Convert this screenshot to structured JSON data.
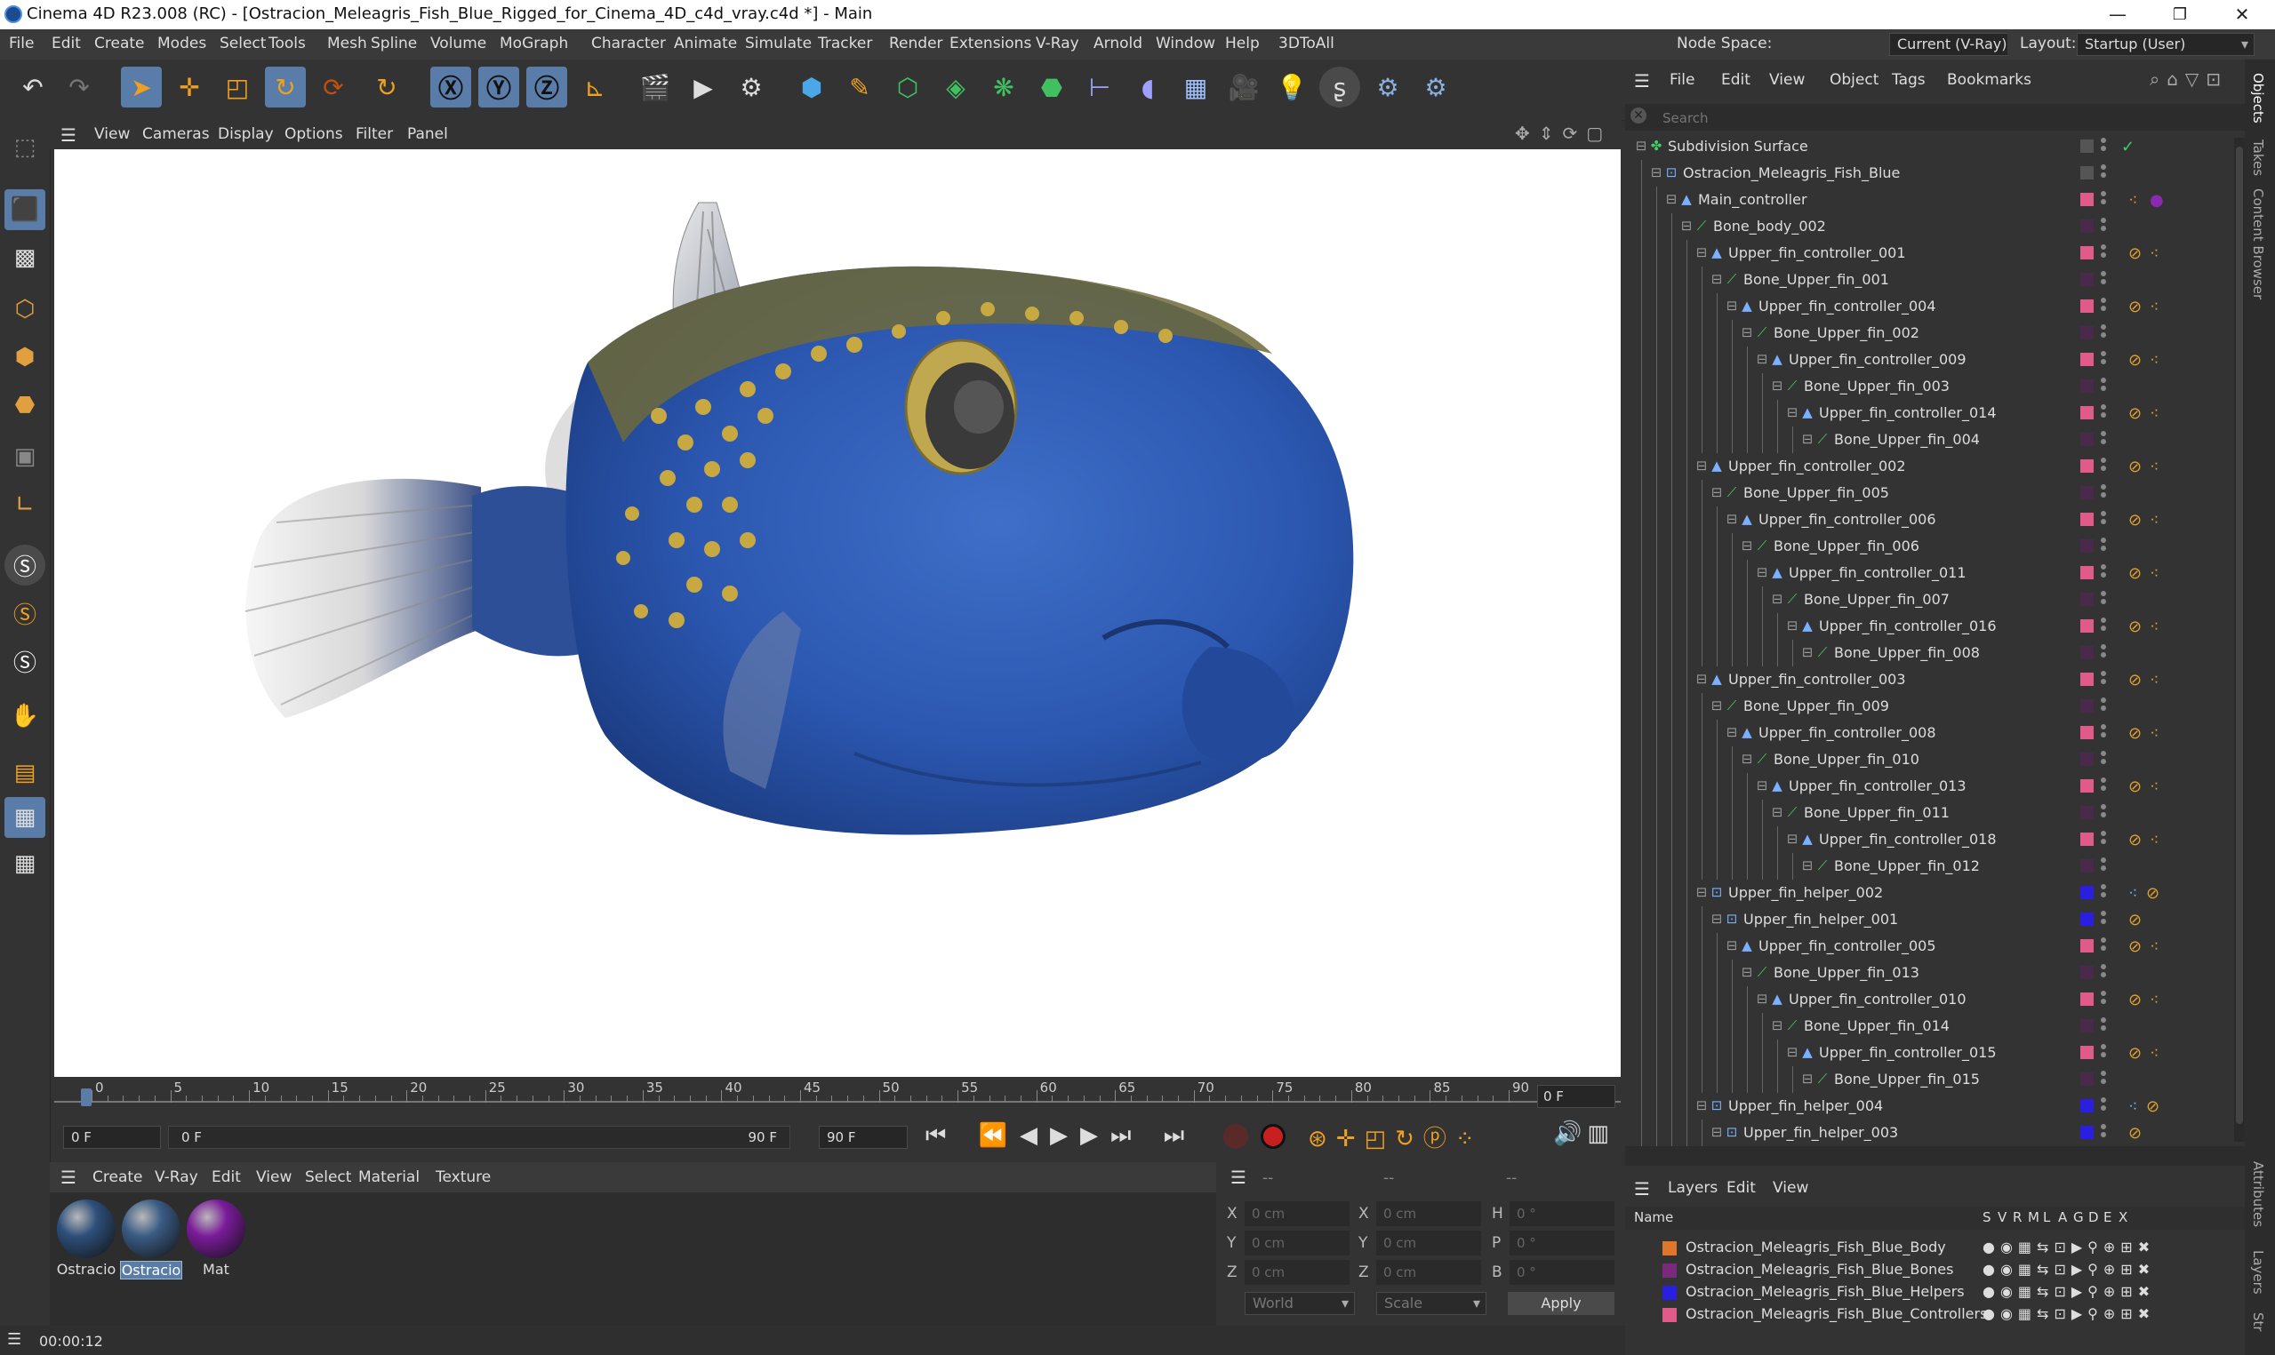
{
  "window": {
    "title": "Cinema 4D R23.008 (RC) - [Ostracion_Meleagris_Fish_Blue_Rigged_for_Cinema_4D_c4d_vray.c4d *] - Main",
    "controls": [
      "—",
      "❐",
      "✕"
    ]
  },
  "menu": [
    "File",
    "Edit",
    "Create",
    "Modes",
    "Select",
    "Tools",
    "Mesh",
    "Spline",
    "Volume",
    "MoGraph",
    "Character",
    "Animate",
    "Simulate",
    "Tracker",
    "Render",
    "Extensions",
    "V-Ray",
    "Arnold",
    "Window",
    "Help",
    "3DToAll"
  ],
  "node_space": {
    "label": "Node Space:",
    "value": "Current (V-Ray)"
  },
  "layout": {
    "label": "Layout:",
    "value": "Startup (User)"
  },
  "viewport_menu": [
    "View",
    "Cameras",
    "Display",
    "Options",
    "Filter",
    "Panel"
  ],
  "timeline": {
    "ticks": [
      "0",
      "5",
      "10",
      "15",
      "20",
      "25",
      "30",
      "35",
      "40",
      "45",
      "50",
      "55",
      "60",
      "65",
      "70",
      "75",
      "80",
      "85",
      "90"
    ],
    "current_frame": "0 F",
    "start_field": "0 F",
    "range_start": "0 F",
    "range_end": "90 F",
    "end_field": "90 F"
  },
  "material_menu": [
    "Create",
    "V-Ray",
    "Edit",
    "View",
    "Select",
    "Material",
    "Texture"
  ],
  "materials": [
    {
      "label": "Ostracio",
      "color": "#2d4f7a",
      "selected": false
    },
    {
      "label": "Ostracio",
      "color": "#3a5b84",
      "selected": true
    },
    {
      "label": "Mat",
      "color": "#7a1b9a",
      "selected": false
    }
  ],
  "coords": {
    "header_dashes": [
      "--",
      "--",
      "--"
    ],
    "rows": [
      {
        "a": "X",
        "av": "0 cm",
        "b": "X",
        "bv": "0 cm",
        "c": "H",
        "cv": "0 °"
      },
      {
        "a": "Y",
        "av": "0 cm",
        "b": "Y",
        "bv": "0 cm",
        "c": "P",
        "cv": "0 °"
      },
      {
        "a": "Z",
        "av": "0 cm",
        "b": "Z",
        "bv": "0 cm",
        "c": "B",
        "cv": "0 °"
      }
    ],
    "mode": "World",
    "scale": "Scale",
    "apply": "Apply"
  },
  "status_time": "00:00:12",
  "object_menu": [
    "File",
    "Edit",
    "View",
    "Object",
    "Tags",
    "Bookmarks"
  ],
  "search_placeholder": "Search",
  "objects": [
    {
      "name": "Subdivision Surface",
      "depth": 0,
      "type": "subd",
      "color": "#555",
      "tags": "check"
    },
    {
      "name": "Ostracion_Meleagris_Fish_Blue",
      "depth": 1,
      "type": "null",
      "color": "#555",
      "tags": ""
    },
    {
      "name": "Main_controller",
      "depth": 2,
      "type": "ctrl",
      "color": "#e05a8a",
      "tags": "matsphere"
    },
    {
      "name": "Bone_body_002",
      "depth": 3,
      "type": "bone",
      "color": "#4a2a4a",
      "tags": ""
    },
    {
      "name": "Upper_fin_controller_001",
      "depth": 4,
      "type": "ctrl",
      "color": "#e05a8a",
      "tags": "ctag"
    },
    {
      "name": "Bone_Upper_fin_001",
      "depth": 5,
      "type": "bone",
      "color": "#4a2a4a",
      "tags": ""
    },
    {
      "name": "Upper_fin_controller_004",
      "depth": 6,
      "type": "ctrl",
      "color": "#e05a8a",
      "tags": "ctag"
    },
    {
      "name": "Bone_Upper_fin_002",
      "depth": 7,
      "type": "bone",
      "color": "#4a2a4a",
      "tags": ""
    },
    {
      "name": "Upper_fin_controller_009",
      "depth": 8,
      "type": "ctrl",
      "color": "#e05a8a",
      "tags": "ctag"
    },
    {
      "name": "Bone_Upper_fin_003",
      "depth": 9,
      "type": "bone",
      "color": "#4a2a4a",
      "tags": ""
    },
    {
      "name": "Upper_fin_controller_014",
      "depth": 10,
      "type": "ctrl",
      "color": "#e05a8a",
      "tags": "ctag"
    },
    {
      "name": "Bone_Upper_fin_004",
      "depth": 11,
      "type": "bone",
      "color": "#4a2a4a",
      "tags": ""
    },
    {
      "name": "Upper_fin_controller_002",
      "depth": 4,
      "type": "ctrl",
      "color": "#e05a8a",
      "tags": "ctag"
    },
    {
      "name": "Bone_Upper_fin_005",
      "depth": 5,
      "type": "bone",
      "color": "#4a2a4a",
      "tags": ""
    },
    {
      "name": "Upper_fin_controller_006",
      "depth": 6,
      "type": "ctrl",
      "color": "#e05a8a",
      "tags": "ctag"
    },
    {
      "name": "Bone_Upper_fin_006",
      "depth": 7,
      "type": "bone",
      "color": "#4a2a4a",
      "tags": ""
    },
    {
      "name": "Upper_fin_controller_011",
      "depth": 8,
      "type": "ctrl",
      "color": "#e05a8a",
      "tags": "ctag"
    },
    {
      "name": "Bone_Upper_fin_007",
      "depth": 9,
      "type": "bone",
      "color": "#4a2a4a",
      "tags": ""
    },
    {
      "name": "Upper_fin_controller_016",
      "depth": 10,
      "type": "ctrl",
      "color": "#e05a8a",
      "tags": "ctag"
    },
    {
      "name": "Bone_Upper_fin_008",
      "depth": 11,
      "type": "bone",
      "color": "#4a2a4a",
      "tags": ""
    },
    {
      "name": "Upper_fin_controller_003",
      "depth": 4,
      "type": "ctrl",
      "color": "#e05a8a",
      "tags": "ctag"
    },
    {
      "name": "Bone_Upper_fin_009",
      "depth": 5,
      "type": "bone",
      "color": "#4a2a4a",
      "tags": ""
    },
    {
      "name": "Upper_fin_controller_008",
      "depth": 6,
      "type": "ctrl",
      "color": "#e05a8a",
      "tags": "ctag"
    },
    {
      "name": "Bone_Upper_fin_010",
      "depth": 7,
      "type": "bone",
      "color": "#4a2a4a",
      "tags": ""
    },
    {
      "name": "Upper_fin_controller_013",
      "depth": 8,
      "type": "ctrl",
      "color": "#e05a8a",
      "tags": "ctag"
    },
    {
      "name": "Bone_Upper_fin_011",
      "depth": 9,
      "type": "bone",
      "color": "#4a2a4a",
      "tags": ""
    },
    {
      "name": "Upper_fin_controller_018",
      "depth": 10,
      "type": "ctrl",
      "color": "#e05a8a",
      "tags": "ctag"
    },
    {
      "name": "Bone_Upper_fin_012",
      "depth": 11,
      "type": "bone",
      "color": "#4a2a4a",
      "tags": ""
    },
    {
      "name": "Upper_fin_helper_002",
      "depth": 4,
      "type": "null",
      "color": "#2a1fe0",
      "tags": "htag"
    },
    {
      "name": "Upper_fin_helper_001",
      "depth": 5,
      "type": "null",
      "color": "#2a1fe0",
      "tags": "prot"
    },
    {
      "name": "Upper_fin_controller_005",
      "depth": 6,
      "type": "ctrl",
      "color": "#e05a8a",
      "tags": "ctag"
    },
    {
      "name": "Bone_Upper_fin_013",
      "depth": 7,
      "type": "bone",
      "color": "#4a2a4a",
      "tags": ""
    },
    {
      "name": "Upper_fin_controller_010",
      "depth": 8,
      "type": "ctrl",
      "color": "#e05a8a",
      "tags": "ctag"
    },
    {
      "name": "Bone_Upper_fin_014",
      "depth": 9,
      "type": "bone",
      "color": "#4a2a4a",
      "tags": ""
    },
    {
      "name": "Upper_fin_controller_015",
      "depth": 10,
      "type": "ctrl",
      "color": "#e05a8a",
      "tags": "ctag"
    },
    {
      "name": "Bone_Upper_fin_015",
      "depth": 11,
      "type": "bone",
      "color": "#4a2a4a",
      "tags": ""
    },
    {
      "name": "Upper_fin_helper_004",
      "depth": 4,
      "type": "null",
      "color": "#2a1fe0",
      "tags": "htag"
    },
    {
      "name": "Upper_fin_helper_003",
      "depth": 5,
      "type": "null",
      "color": "#2a1fe0",
      "tags": "prot"
    }
  ],
  "layers_menu": [
    "Layers",
    "Edit",
    "View"
  ],
  "layers_header": {
    "name": "Name",
    "cols": [
      "S",
      "V",
      "R",
      "M",
      "L",
      "A",
      "G",
      "D",
      "E",
      "X"
    ]
  },
  "layers": [
    {
      "name": "Ostracion_Meleagris_Fish_Blue_Body",
      "color": "#e0762a"
    },
    {
      "name": "Ostracion_Meleagris_Fish_Blue_Bones",
      "color": "#7a2a7a"
    },
    {
      "name": "Ostracion_Meleagris_Fish_Blue_Helpers",
      "color": "#2a1fe0"
    },
    {
      "name": "Ostracion_Meleagris_Fish_Blue_Controllers",
      "color": "#e05a8a"
    }
  ],
  "right_tabs": [
    "Objects",
    "Takes",
    "Content Browser",
    "Attributes",
    "Layers",
    "Str"
  ]
}
